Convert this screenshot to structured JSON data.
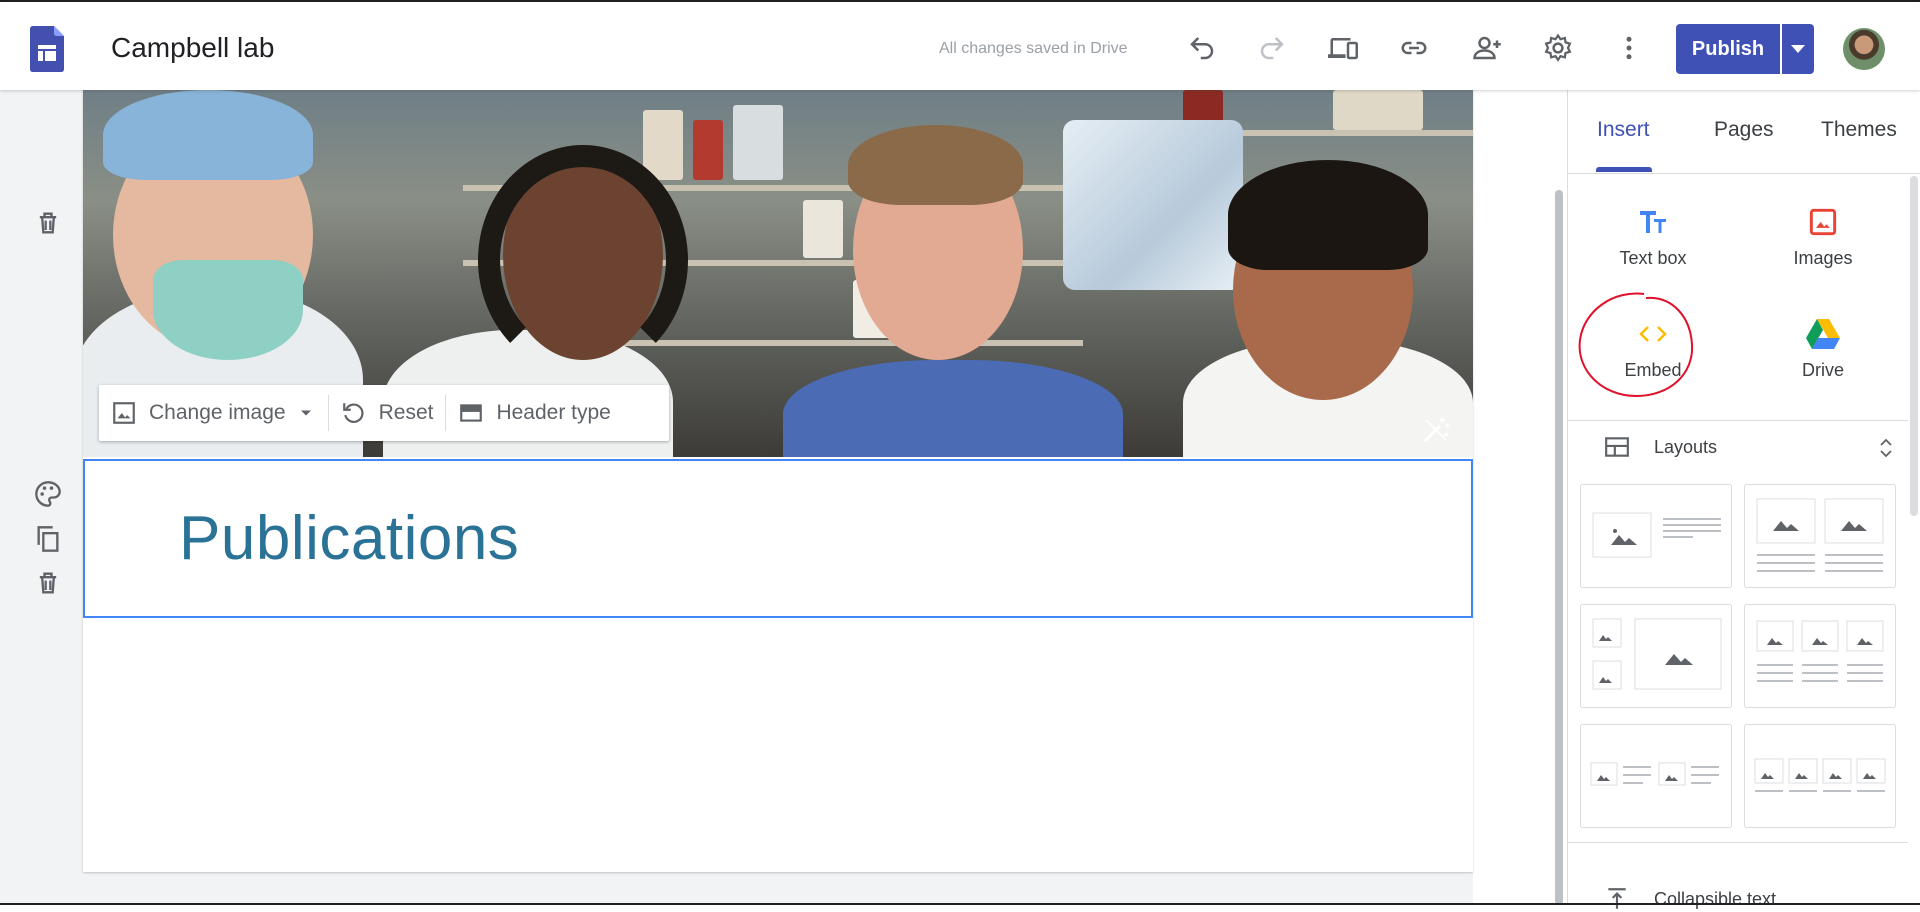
{
  "header": {
    "site_title": "Campbell lab",
    "save_status": "All changes saved in Drive",
    "publish_label": "Publish",
    "logo_icon": "google-sites-logo-icon",
    "toolbar_icons": [
      "undo-icon",
      "redo-icon",
      "preview-devices-icon",
      "link-icon",
      "share-icon",
      "settings-icon",
      "more-vert-icon"
    ]
  },
  "hero": {
    "change_image_label": "Change image",
    "reset_label": "Reset",
    "header_type_label": "Header type"
  },
  "page": {
    "title": "Publications"
  },
  "panel": {
    "tabs": [
      {
        "label": "Insert",
        "active": true
      },
      {
        "label": "Pages",
        "active": false
      },
      {
        "label": "Themes",
        "active": false
      }
    ],
    "insert_items": [
      {
        "label": "Text box",
        "icon": "text-box-icon"
      },
      {
        "label": "Images",
        "icon": "image-icon"
      },
      {
        "label": "Embed",
        "icon": "embed-code-icon"
      },
      {
        "label": "Drive",
        "icon": "google-drive-icon"
      }
    ],
    "layouts_label": "Layouts",
    "collapsible_label": "Collapsible text"
  },
  "colors": {
    "accent": "#3f51b5",
    "title_text": "#2a7397",
    "selection": "#4285f4",
    "annotation": "#e0112b"
  }
}
